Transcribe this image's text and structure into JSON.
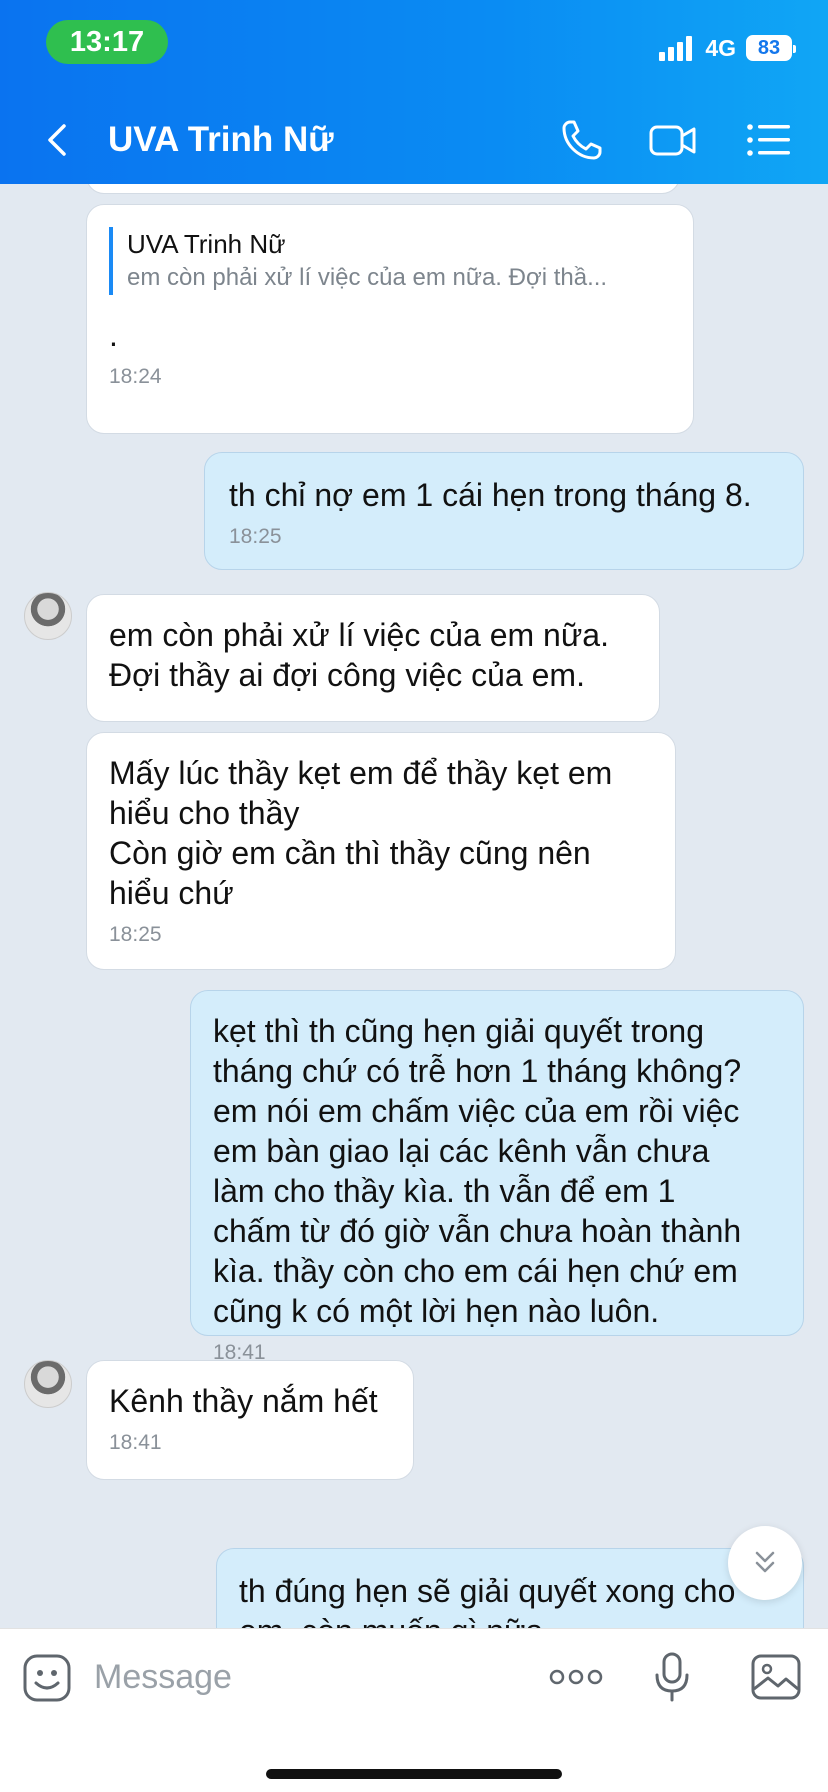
{
  "status_bar": {
    "time": "13:17",
    "network": "4G",
    "battery": "83"
  },
  "header": {
    "title": "UVA Trinh Nữ"
  },
  "messages": [
    {
      "quoted_name": "UVA Trinh Nữ",
      "quoted_text": "em còn phải xử lí việc của em nữa. Đợi thầ...",
      "text": ".",
      "time": "18:24"
    },
    {
      "text": "th chỉ nợ em 1 cái hẹn trong tháng 8.",
      "time": "18:25"
    },
    {
      "text": "em còn phải xử lí việc của em nữa.\nĐợi thầy ai đợi công việc của em."
    },
    {
      "text": "Mấy lúc thầy kẹt em để thầy kẹt em\nhiểu cho thầy\nCòn giờ em cần thì thầy cũng nên\nhiểu chứ",
      "time": "18:25"
    },
    {
      "text": "kẹt thì th cũng hẹn giải quyết trong\ntháng chứ có trễ hơn 1 tháng không?\nem nói em chấm việc của em rồi việc\nem bàn giao lại các kênh vẫn chưa\nlàm cho thầy kìa. th vẫn để em 1\nchấm từ đó giờ vẫn chưa hoàn thành\nkìa. thầy còn cho em cái hẹn chứ em\ncũng k có một lời hẹn nào luôn.",
      "time": "18:41"
    },
    {
      "text": "Kênh thầy nắm hết",
      "time": "18:41"
    },
    {
      "text": "th đúng hẹn sẽ giải quyết xong cho\nem, còn muốn gì nữa"
    }
  ],
  "input": {
    "placeholder": "Message"
  }
}
